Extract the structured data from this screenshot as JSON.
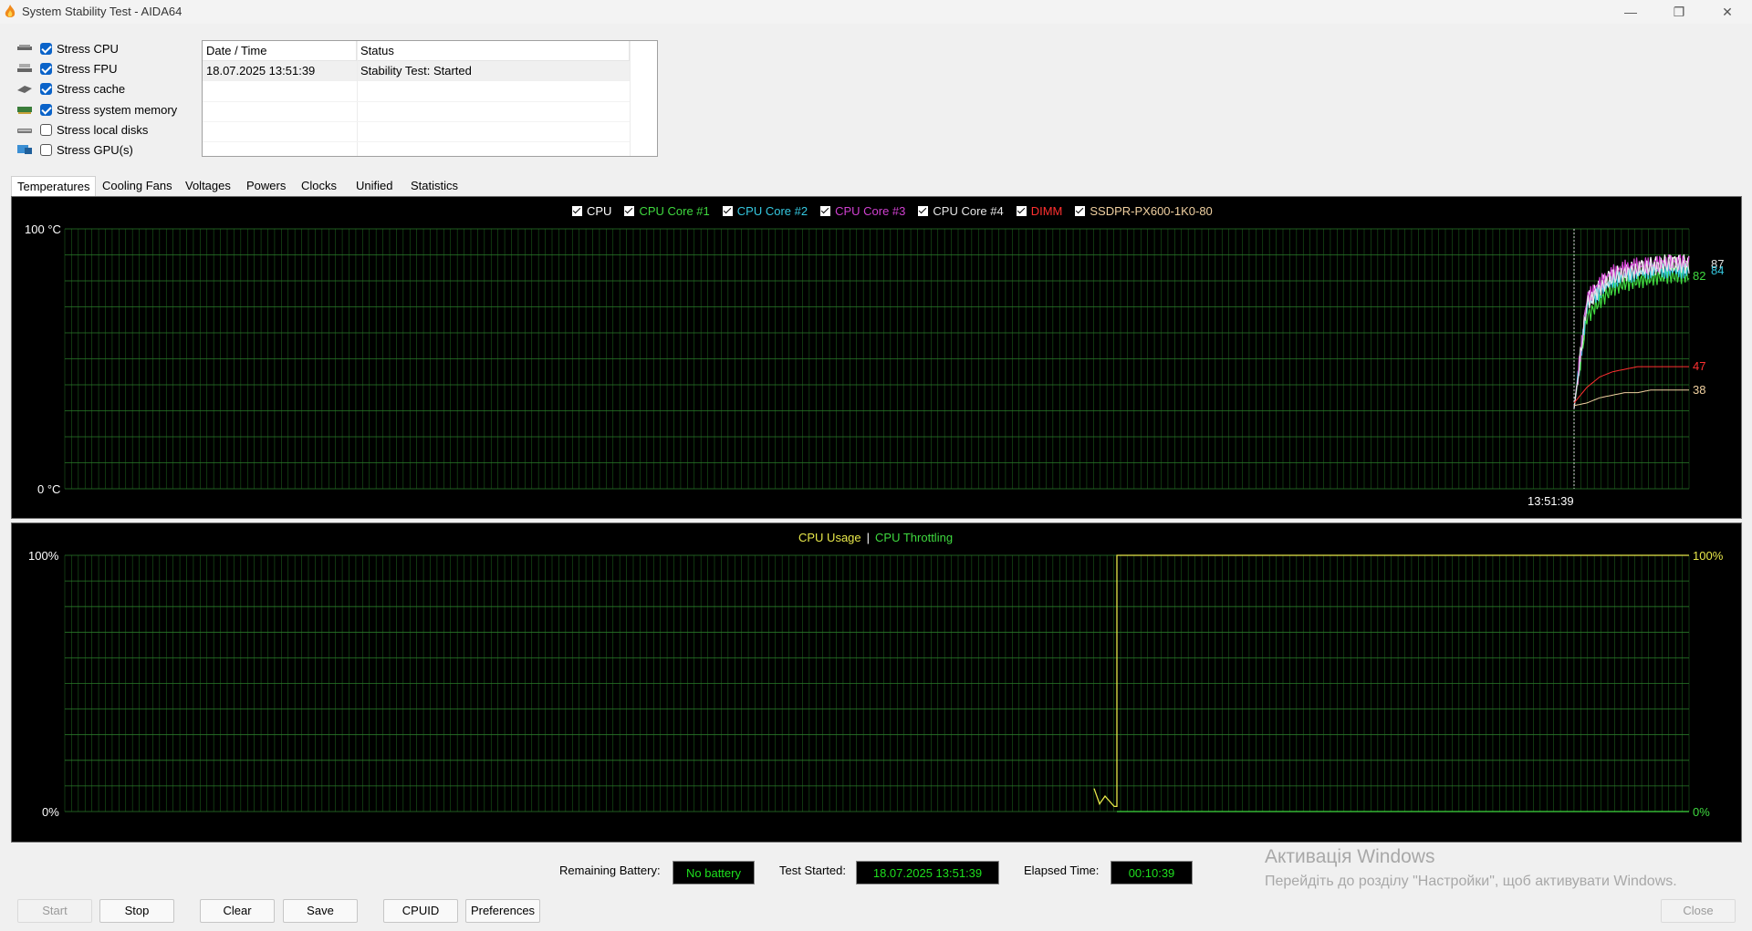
{
  "window": {
    "title": "System Stability Test - AIDA64",
    "minimize_glyph": "—",
    "maximize_glyph": "❐",
    "close_glyph": "✕"
  },
  "stress_options": [
    {
      "label": "Stress CPU",
      "checked": true,
      "icon": "cpu-icon"
    },
    {
      "label": "Stress FPU",
      "checked": true,
      "icon": "fpu-icon"
    },
    {
      "label": "Stress cache",
      "checked": true,
      "icon": "cache-icon"
    },
    {
      "label": "Stress system memory",
      "checked": true,
      "icon": "memory-icon"
    },
    {
      "label": "Stress local disks",
      "checked": false,
      "icon": "disk-icon"
    },
    {
      "label": "Stress GPU(s)",
      "checked": false,
      "icon": "gpu-icon"
    }
  ],
  "log": {
    "columns": [
      "Date / Time",
      "Status"
    ],
    "rows": [
      [
        "18.07.2025 13:51:39",
        "Stability Test: Started"
      ]
    ]
  },
  "tabs": [
    "Temperatures",
    "Cooling Fans",
    "Voltages",
    "Powers",
    "Clocks",
    "Unified",
    "Statistics"
  ],
  "active_tab": "Temperatures",
  "temperature_chart": {
    "legend": [
      {
        "label": "CPU",
        "color": "#ffffff"
      },
      {
        "label": "CPU Core #1",
        "color": "#3fd93f"
      },
      {
        "label": "CPU Core #2",
        "color": "#35c8e0"
      },
      {
        "label": "CPU Core #3",
        "color": "#d040d0"
      },
      {
        "label": "CPU Core #4",
        "color": "#e6e6e6"
      },
      {
        "label": "DIMM",
        "color": "#ff3030"
      },
      {
        "label": "SSDPR-PX600-1K0-80",
        "color": "#f0d0a0"
      }
    ],
    "y_top_label": "100",
    "y_bottom_label": "0",
    "unit_label": "°C",
    "time_marker_label": "13:51:39",
    "end_labels": [
      {
        "text": "87",
        "color": "#e0e0e0"
      },
      {
        "text": "82",
        "color": "#3fd93f"
      },
      {
        "text": "84",
        "color": "#35c8e0"
      },
      {
        "text": "47",
        "color": "#ff3030"
      },
      {
        "text": "38",
        "color": "#f0d0a0"
      }
    ]
  },
  "usage_chart": {
    "legend_usage": "CPU Usage",
    "legend_sep": "|",
    "legend_throttle": "CPU Throttling",
    "usage_color": "#e8e84a",
    "throttle_color": "#3fd93f",
    "y_top_label": "100%",
    "y_bottom_label": "0%",
    "right_top_label": "100%",
    "right_bottom_label": "0%"
  },
  "chart_data": [
    {
      "type": "line",
      "ylabel": "°C",
      "ylim": [
        0,
        100
      ],
      "grid": true,
      "series": [
        {
          "name": "CPU",
          "values": [
            31,
            72,
            78,
            82,
            84,
            85,
            86,
            87,
            87,
            87
          ]
        },
        {
          "name": "CPU Core #1",
          "values": [
            31,
            66,
            72,
            77,
            79,
            80,
            81,
            82,
            82,
            82
          ]
        },
        {
          "name": "CPU Core #2",
          "values": [
            31,
            70,
            76,
            80,
            82,
            83,
            84,
            84,
            84,
            84
          ]
        },
        {
          "name": "CPU Core #3",
          "values": [
            31,
            73,
            79,
            83,
            85,
            86,
            86,
            87,
            87,
            87
          ]
        },
        {
          "name": "CPU Core #4",
          "values": [
            31,
            71,
            77,
            81,
            83,
            84,
            85,
            86,
            86,
            86
          ]
        },
        {
          "name": "DIMM",
          "values": [
            33,
            39,
            43,
            45,
            46,
            47,
            47,
            47,
            47,
            47
          ]
        },
        {
          "name": "SSDPR-PX600-1K0-80",
          "values": [
            32,
            33,
            35,
            36,
            37,
            37,
            38,
            38,
            38,
            38
          ]
        }
      ]
    },
    {
      "type": "line",
      "ylim": [
        0,
        100
      ],
      "grid": true,
      "series": [
        {
          "name": "CPU Usage",
          "values": [
            9,
            3,
            6,
            2,
            100,
            100,
            100,
            100,
            100
          ]
        },
        {
          "name": "CPU Throttling",
          "values": [
            0,
            0,
            0,
            0,
            0,
            0,
            0,
            0,
            0
          ]
        }
      ]
    }
  ],
  "status": {
    "battery_label": "Remaining Battery:",
    "battery_value": "No battery",
    "started_label": "Test Started:",
    "started_value": "18.07.2025 13:51:39",
    "elapsed_label": "Elapsed Time:",
    "elapsed_value": "00:10:39"
  },
  "buttons": {
    "start": "Start",
    "stop": "Stop",
    "clear": "Clear",
    "save": "Save",
    "cpuid": "CPUID",
    "preferences": "Preferences",
    "close": "Close"
  },
  "watermark": {
    "line1": "Активація Windows",
    "line2": "Перейдіть до розділу \"Настройки\", щоб активувати Windows."
  }
}
